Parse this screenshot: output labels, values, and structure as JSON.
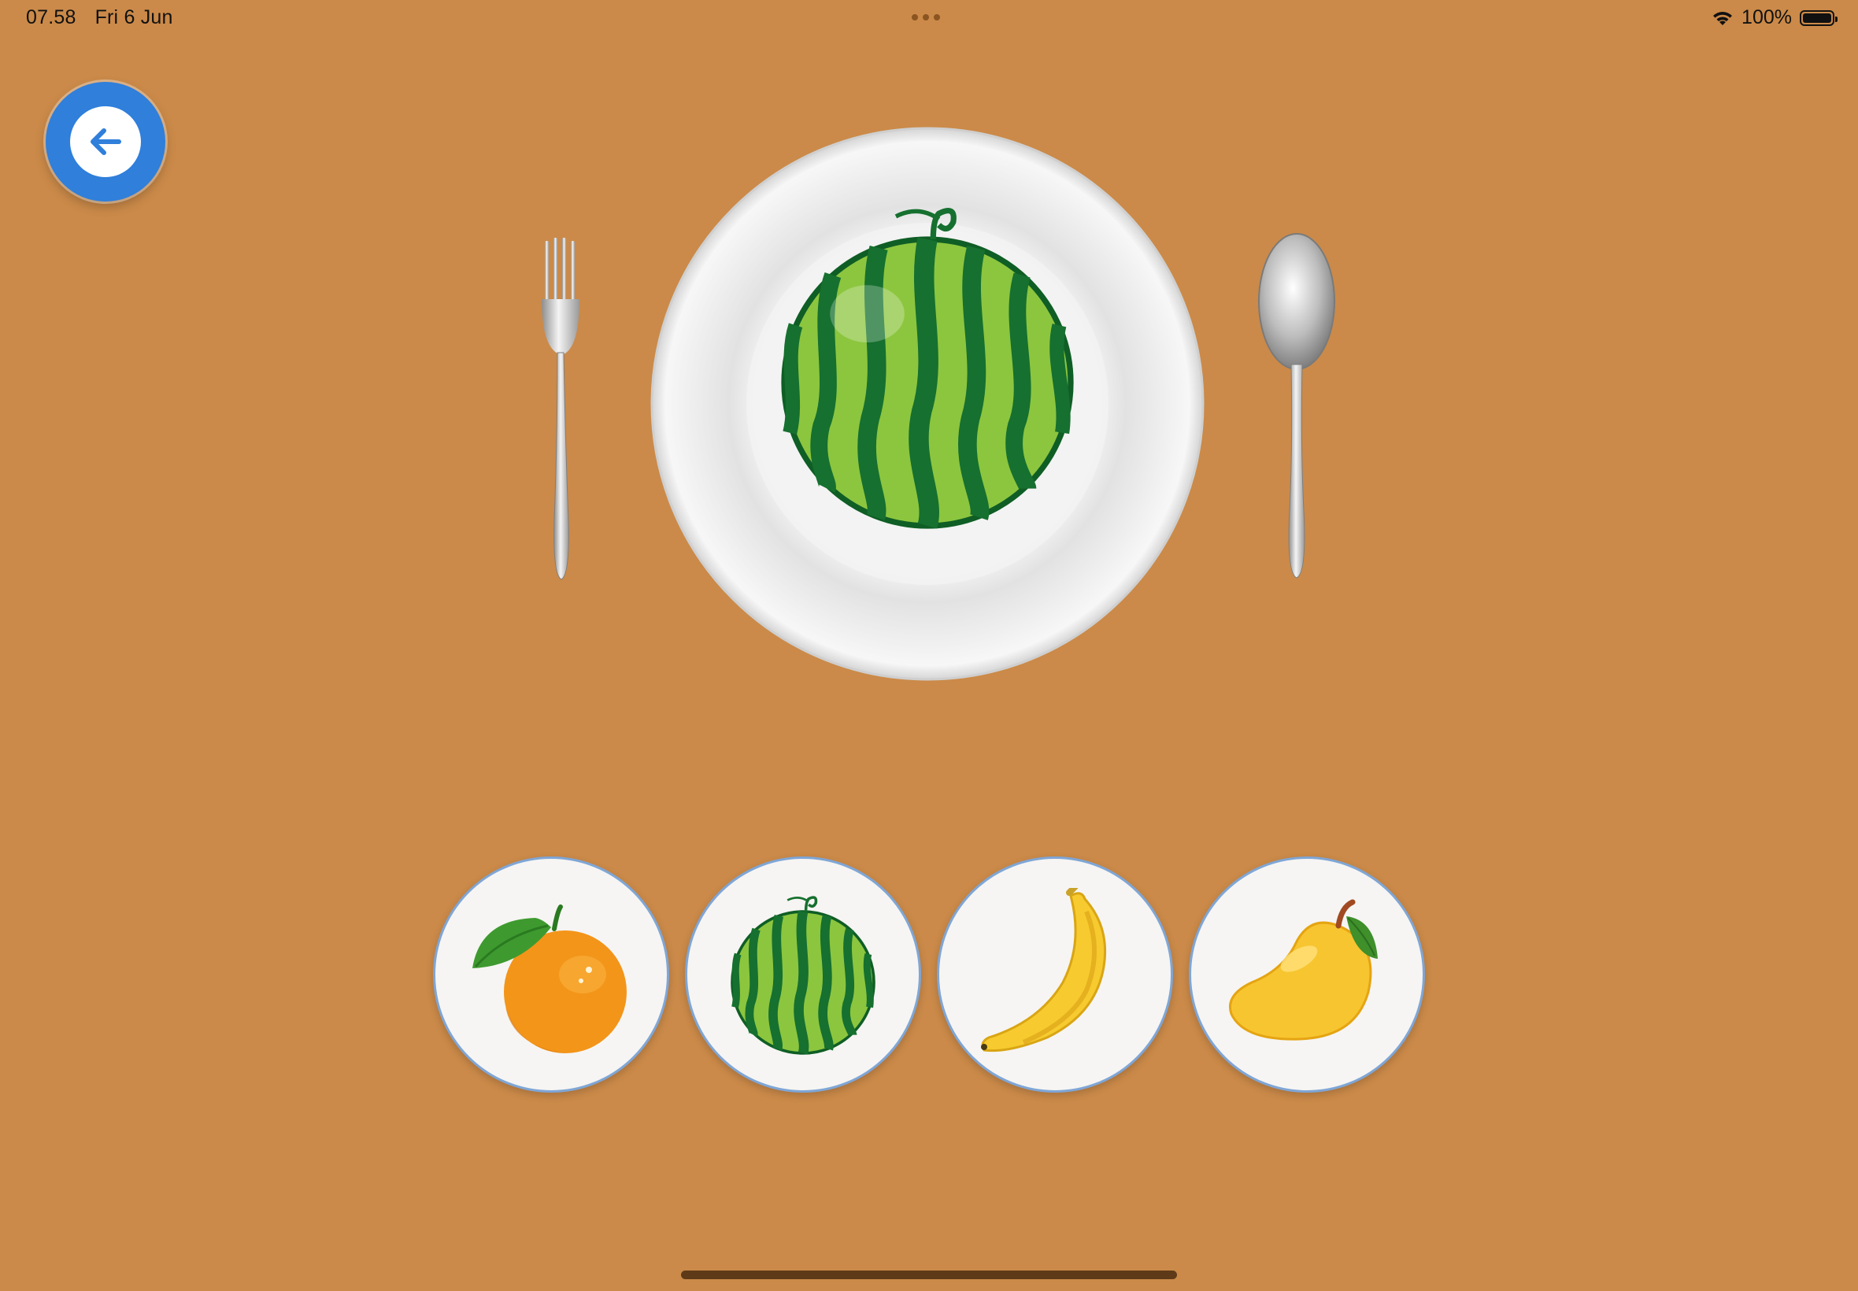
{
  "status_bar": {
    "time": "07.58",
    "date": "Fri 6 Jun",
    "battery": "100%"
  },
  "navigation": {
    "back_icon": "arrow-left-icon"
  },
  "table": {
    "plate_item": "watermelon",
    "utensils": [
      "fork",
      "spoon"
    ]
  },
  "choices": [
    {
      "id": "orange",
      "icon": "orange-icon"
    },
    {
      "id": "watermelon",
      "icon": "watermelon-icon"
    },
    {
      "id": "banana",
      "icon": "banana-icon"
    },
    {
      "id": "mango",
      "icon": "mango-icon"
    }
  ],
  "colors": {
    "background": "#CB8A49",
    "accent": "#2F7FDB",
    "choice_border": "#7FA6D6"
  }
}
